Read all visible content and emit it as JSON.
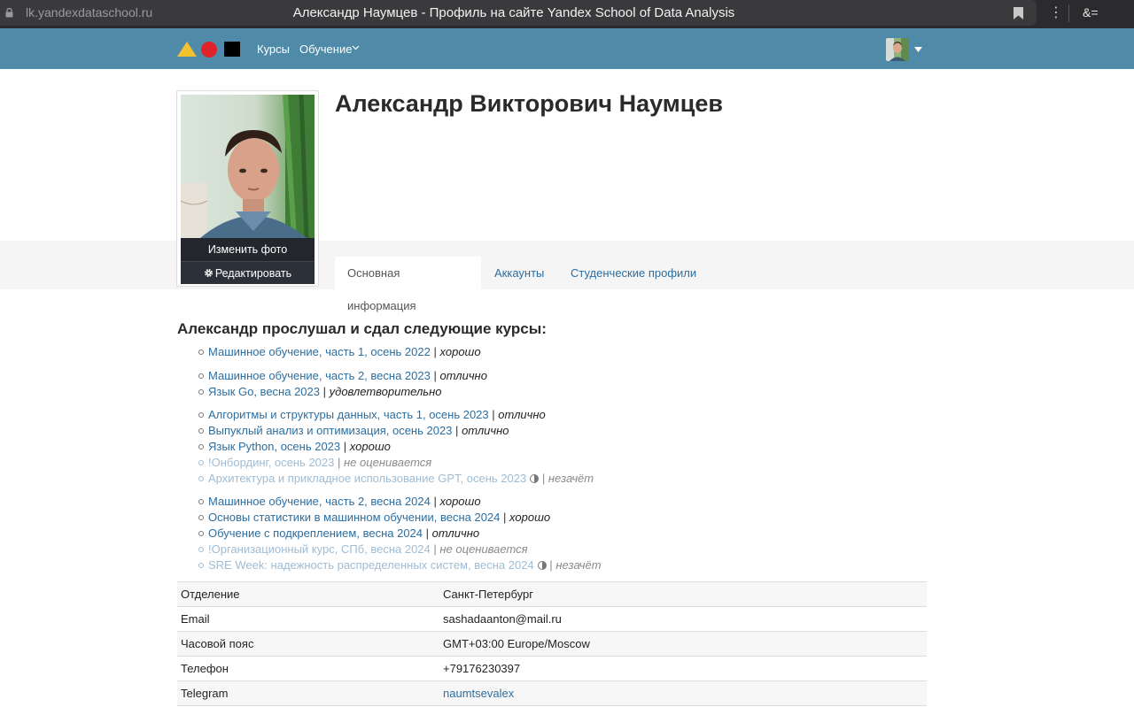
{
  "browser": {
    "url": "lk.yandexdataschool.ru",
    "window_title": "Александр Наумцев - Профиль на сайте Yandex School of Data Analysis",
    "reader_label": "&="
  },
  "navbar": {
    "bg_color": "#4f8aa8",
    "courses_label": "Курсы",
    "study_label": "Обучение"
  },
  "profile": {
    "name": "Александр Викторович Наумцев",
    "change_photo_label": "Изменить фото",
    "edit_label": "Редактировать"
  },
  "tabs": [
    {
      "label": "Основная информация",
      "active": true
    },
    {
      "label": "Аккаунты",
      "active": false
    },
    {
      "label": "Студенческие профили",
      "active": false
    }
  ],
  "courses": {
    "title": "Александр прослушал и сдал следующие курсы:",
    "items": [
      {
        "name": "Машинное обучение, часть 1, осень 2022",
        "grade": "хорошо"
      },
      {
        "name": "Машинное обучение, часть 2, весна 2023",
        "grade": "отлично"
      },
      {
        "name": "Язык Go, весна 2023",
        "grade": "удовлетворительно"
      },
      {
        "name": "Алгоритмы и структуры данных, часть 1, осень 2023",
        "grade": "отлично"
      },
      {
        "name": "Выпуклый анализ и оптимизация, осень 2023",
        "grade": "отлично"
      },
      {
        "name": "Язык Python, осень 2023",
        "grade": "хорошо"
      },
      {
        "name": "!Онбординг, осень 2023",
        "grade": "не оценивается"
      },
      {
        "name": "Архитектура и прикладное использование GPT, осень 2023",
        "grade": "незачёт"
      },
      {
        "name": "Машинное обучение, часть 2, весна 2024",
        "grade": "хорошо"
      },
      {
        "name": "Основы статистики в машинном обучении, весна 2024",
        "grade": "хорошо"
      },
      {
        "name": "Обучение с подкреплением, весна 2024",
        "grade": "отлично"
      },
      {
        "name": "!Организационный курс, СПб, весна 2024",
        "grade": "не оценивается"
      },
      {
        "name": "SRE Week: надежность распределенных систем, весна 2024",
        "grade": "незачёт"
      }
    ]
  },
  "info": [
    {
      "key": "Отделение",
      "value": "Санкт-Петербург"
    },
    {
      "key": "Email",
      "value": "sashadaanton@mail.ru"
    },
    {
      "key": "Часовой пояс",
      "value": "GMT+03:00 Europe/Moscow"
    },
    {
      "key": "Телефон",
      "value": "+79176230397"
    },
    {
      "key": "Telegram",
      "value": "naumtsevalex"
    }
  ]
}
